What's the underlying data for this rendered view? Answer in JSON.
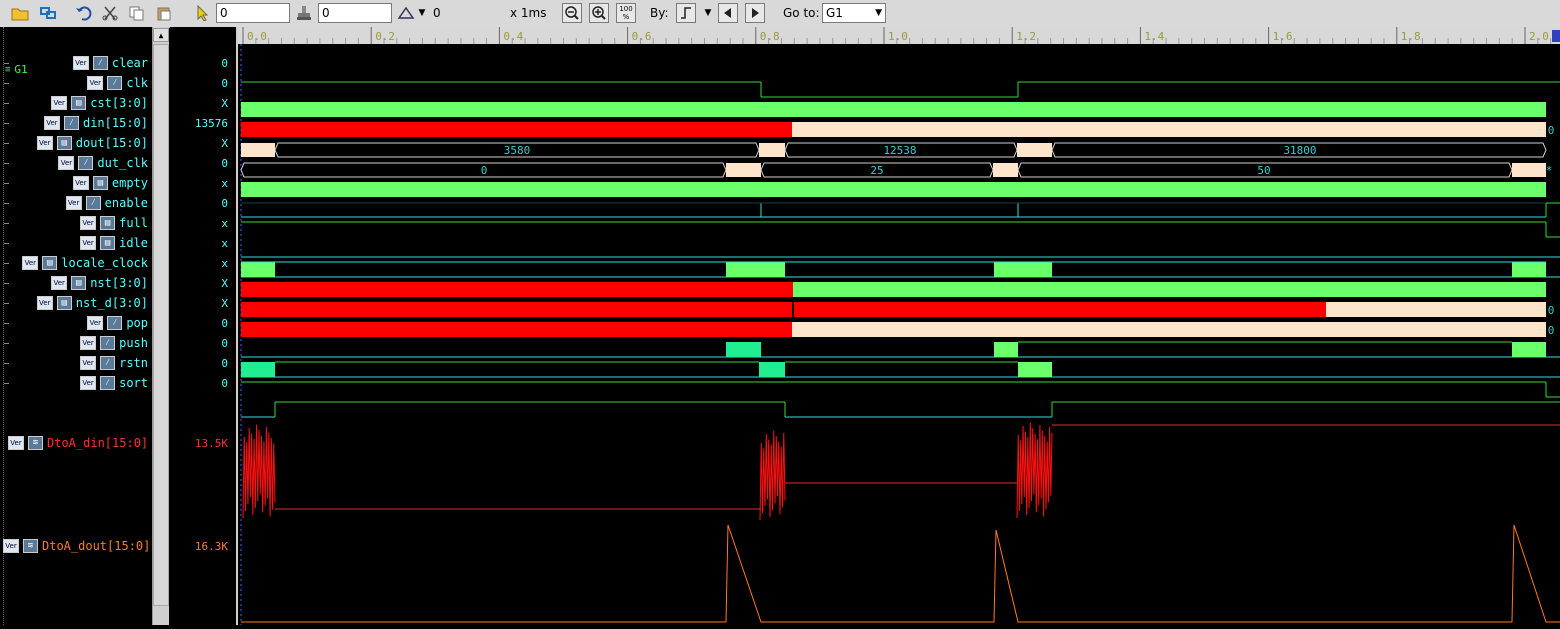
{
  "toolbar": {
    "cursor_value": "0",
    "delta_value": "0",
    "marker_value": "0",
    "time_unit": "x 1ms",
    "zoom_fit_label": "100 %",
    "by_label": "By:",
    "goto_label": "Go to:",
    "goto_value": "G1"
  },
  "timeline": {
    "ticks": [
      "0.0",
      "0.2",
      "0.4",
      "0.6",
      "0.8",
      "1.0",
      "1.2",
      "1.4",
      "1.6",
      "1.8",
      "2.0"
    ]
  },
  "group": {
    "label": "G1"
  },
  "signals": [
    {
      "name": "clear",
      "value": "0",
      "badge": "Ver",
      "icon": "wave-icon"
    },
    {
      "name": "clk",
      "value": "0",
      "badge": "Ver",
      "icon": "wave-icon"
    },
    {
      "name": "cst[3:0]",
      "value": "X",
      "badge": "Ver",
      "icon": "net-icon"
    },
    {
      "name": "din[15:0]",
      "value": "13576",
      "badge": "Ver",
      "icon": "wave-icon"
    },
    {
      "name": "dout[15:0]",
      "value": "X",
      "badge": "Ver",
      "icon": "net-icon"
    },
    {
      "name": "dut_clk",
      "value": "0",
      "badge": "Ver",
      "icon": "wave-icon"
    },
    {
      "name": "empty",
      "value": "x",
      "badge": "Ver",
      "icon": "net-icon"
    },
    {
      "name": "enable",
      "value": "0",
      "badge": "Ver",
      "icon": "wave-icon"
    },
    {
      "name": "full",
      "value": "x",
      "badge": "Ver",
      "icon": "net-icon"
    },
    {
      "name": "idle",
      "value": "x",
      "badge": "Ver",
      "icon": "net-icon"
    },
    {
      "name": "locale_clock",
      "value": "x",
      "badge": "Ver",
      "icon": "net-icon"
    },
    {
      "name": "nst[3:0]",
      "value": "X",
      "badge": "Ver",
      "icon": "net-icon"
    },
    {
      "name": "nst_d[3:0]",
      "value": "X",
      "badge": "Ver",
      "icon": "net-icon"
    },
    {
      "name": "pop",
      "value": "0",
      "badge": "Ver",
      "icon": "wave-icon"
    },
    {
      "name": "push",
      "value": "0",
      "badge": "Ver",
      "icon": "wave-icon"
    },
    {
      "name": "rstn",
      "value": "0",
      "badge": "Ver",
      "icon": "wave-icon"
    },
    {
      "name": "sort",
      "value": "0",
      "badge": "Ver",
      "icon": "wave-icon"
    }
  ],
  "analog": [
    {
      "name": "DtoA_din[15:0]",
      "value": "13.5K",
      "badge": "Ver",
      "color": "#ff2020"
    },
    {
      "name": "DtoA_dout[15:0]",
      "value": "16.3K",
      "badge": "Ver",
      "color": "#ff7a20"
    }
  ],
  "bus_labels": {
    "din": [
      "3580",
      "12538",
      "31800"
    ],
    "dout": [
      "0",
      "25",
      "50",
      "*"
    ],
    "cst_end": "0",
    "nst_end": "0",
    "nst_d_end": "0"
  },
  "colors": {
    "green": "#6cff6c",
    "red": "#ff0000",
    "peach": "#ffe4cc",
    "cyan": "#00e0e0",
    "line": "#33dd33"
  }
}
